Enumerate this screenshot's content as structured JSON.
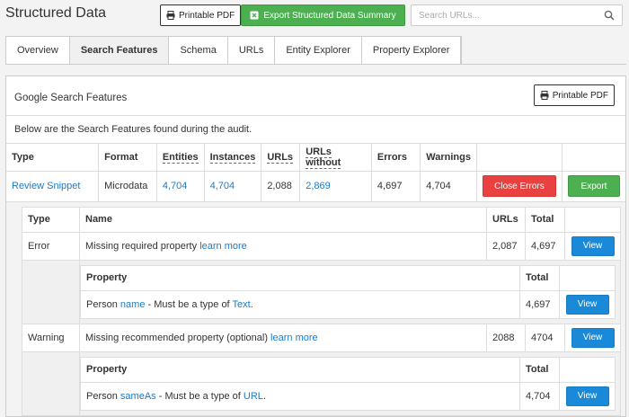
{
  "app": {
    "title": "Structured Data"
  },
  "toolbar": {
    "printable_pdf": "Printable PDF",
    "export_summary": "Export Structured Data Summary",
    "search_placeholder": "Search URLs..."
  },
  "tabs": [
    {
      "label": "Overview"
    },
    {
      "label": "Search Features",
      "active": true
    },
    {
      "label": "Schema"
    },
    {
      "label": "URLs"
    },
    {
      "label": "Entity Explorer"
    },
    {
      "label": "Property Explorer"
    }
  ],
  "panel": {
    "title": "Google Search Features",
    "pdf_label": "Printable PDF",
    "description": "Below are the Search Features found during the audit."
  },
  "main_table": {
    "headers": [
      "Type",
      "Format",
      "Entities",
      "Instances",
      "URLs",
      "URLs without",
      "Errors",
      "Warnings"
    ],
    "row": {
      "type": "Review Snippet",
      "format": "Microdata",
      "entities": "4,704",
      "instances": "4,704",
      "urls": "2,088",
      "urls_without": "2,869",
      "errors": "4,697",
      "warnings": "4,704",
      "close_errors": "Close Errors",
      "export": "Export"
    }
  },
  "issues": {
    "headers": [
      "Type",
      "Name",
      "URLs",
      "Total"
    ],
    "rows": [
      {
        "type": "Error",
        "name": "Missing required property",
        "learn_more": "learn more",
        "urls": "2,087",
        "total": "4,697",
        "view": "View",
        "properties": {
          "headers": [
            "Property",
            "Total"
          ],
          "row": {
            "entity": "Person",
            "prop": "name",
            "sep": "- Must be a type of",
            "expected": "Text",
            "end": ".",
            "total": "4,697",
            "view": "View"
          }
        }
      },
      {
        "type": "Warning",
        "name": "Missing recommended property (optional)",
        "learn_more": "learn more",
        "urls": "2088",
        "total": "4704",
        "view": "View",
        "properties": {
          "headers": [
            "Property",
            "Total"
          ],
          "row": {
            "entity": "Person",
            "prop": "sameAs",
            "sep": "- Must be a type of",
            "expected": "URL",
            "end": ".",
            "total": "4,704",
            "view": "View"
          }
        }
      }
    ]
  },
  "colors": {
    "link": "#1a7bc8",
    "green": "#4caf50",
    "red": "#e94040",
    "blue": "#1a8ad8"
  },
  "icons": [
    "print-icon",
    "export-icon",
    "search-icon"
  ]
}
